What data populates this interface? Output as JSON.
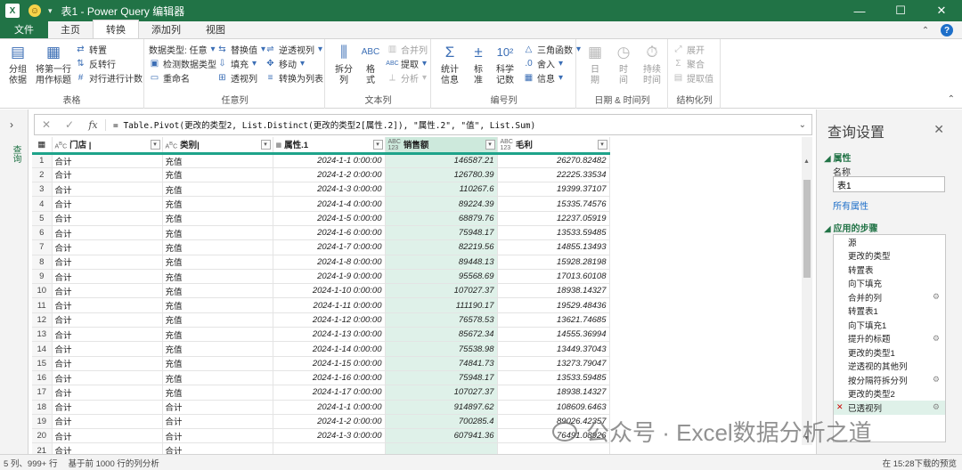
{
  "window": {
    "title": "表1 - Power Query 编辑器",
    "app_badge": "X",
    "minimize_glyph": "—",
    "maximize_glyph": "☐",
    "close_glyph": "✕"
  },
  "tabs": [
    "文件",
    "主页",
    "转换",
    "添加列",
    "视图"
  ],
  "ribbon": {
    "groups": {
      "table": "表格",
      "any_col": "任意列",
      "text_col": "文本列",
      "number_col": "编号列",
      "datetime_col": "日期 & 时间列",
      "structured_col": "结构化列"
    },
    "group_by": "分组\n依据",
    "first_row_header": "将第一行\n用作标题",
    "transpose": "转置",
    "reverse_rows": "反转行",
    "count_rows": "对行进行计数",
    "data_type": "数据类型: 任意",
    "detect_type": "检测数据类型",
    "rename": "重命名",
    "replace_values": "替换值",
    "fill": "填充",
    "pivot_column": "透视列",
    "unpivot": "逆透视列",
    "move": "移动",
    "to_list": "转换为列表",
    "split_column": "拆分\n列",
    "format": "格\n式",
    "merge_columns": "合并列",
    "extract": "提取",
    "parse": "分析",
    "statistics": "统计\n信息",
    "standard": "标\n准",
    "scientific": "科学\n记数",
    "trig": "三角函数",
    "rounding": "舍入",
    "information": "信息",
    "date": "日\n期",
    "time": "时\n间",
    "duration": "持续\n时间",
    "expand": "展开",
    "aggregate": "聚合",
    "extract_values": "提取值"
  },
  "formula": "= Table.Pivot(更改的类型2, List.Distinct(更改的类型2[属性.2]), \"属性.2\", \"值\", List.Sum)",
  "left_pane_label": "查询",
  "columns": [
    {
      "name": "门店",
      "type": "ABC"
    },
    {
      "name": "类别",
      "type": "ABC"
    },
    {
      "name": "属性.1",
      "type": "date"
    },
    {
      "name": "销售额",
      "type": "ABC123"
    },
    {
      "name": "毛利",
      "type": "ABC123"
    }
  ],
  "rows": [
    [
      "1",
      "合计",
      "充值",
      "2024-1-1 0:00:00",
      "146587.21",
      "26270.82482"
    ],
    [
      "2",
      "合计",
      "充值",
      "2024-1-2 0:00:00",
      "126780.39",
      "22225.33534"
    ],
    [
      "3",
      "合计",
      "充值",
      "2024-1-3 0:00:00",
      "110267.6",
      "19399.37107"
    ],
    [
      "4",
      "合计",
      "充值",
      "2024-1-4 0:00:00",
      "89224.39",
      "15335.74576"
    ],
    [
      "5",
      "合计",
      "充值",
      "2024-1-5 0:00:00",
      "68879.76",
      "12237.05919"
    ],
    [
      "6",
      "合计",
      "充值",
      "2024-1-6 0:00:00",
      "75948.17",
      "13533.59485"
    ],
    [
      "7",
      "合计",
      "充值",
      "2024-1-7 0:00:00",
      "82219.56",
      "14855.13493"
    ],
    [
      "8",
      "合计",
      "充值",
      "2024-1-8 0:00:00",
      "89448.13",
      "15928.28198"
    ],
    [
      "9",
      "合计",
      "充值",
      "2024-1-9 0:00:00",
      "95568.69",
      "17013.60108"
    ],
    [
      "10",
      "合计",
      "充值",
      "2024-1-10 0:00:00",
      "107027.37",
      "18938.14327"
    ],
    [
      "11",
      "合计",
      "充值",
      "2024-1-11 0:00:00",
      "111190.17",
      "19529.48436"
    ],
    [
      "12",
      "合计",
      "充值",
      "2024-1-12 0:00:00",
      "76578.53",
      "13621.74685"
    ],
    [
      "13",
      "合计",
      "充值",
      "2024-1-13 0:00:00",
      "85672.34",
      "14555.36994"
    ],
    [
      "14",
      "合计",
      "充值",
      "2024-1-14 0:00:00",
      "75538.98",
      "13449.37043"
    ],
    [
      "15",
      "合计",
      "充值",
      "2024-1-15 0:00:00",
      "74841.73",
      "13273.79047"
    ],
    [
      "16",
      "合计",
      "充值",
      "2024-1-16 0:00:00",
      "75948.17",
      "13533.59485"
    ],
    [
      "17",
      "合计",
      "充值",
      "2024-1-17 0:00:00",
      "107027.37",
      "18938.14327"
    ],
    [
      "18",
      "合计",
      "合计",
      "2024-1-1 0:00:00",
      "914897.62",
      "108609.6463"
    ],
    [
      "19",
      "合计",
      "合计",
      "2024-1-2 0:00:00",
      "700285.4",
      "89026.42357"
    ],
    [
      "20",
      "合计",
      "合计",
      "2024-1-3 0:00:00",
      "607941.36",
      "76491.08926"
    ],
    [
      "21",
      "合计",
      "合计",
      "",
      "",
      ""
    ]
  ],
  "right_pane": {
    "title": "查询设置",
    "properties_header": "属性",
    "name_label": "名称",
    "name_value": "表1",
    "all_properties": "所有属性",
    "steps_header": "应用的步骤",
    "steps": [
      {
        "label": "源",
        "gear": false
      },
      {
        "label": "更改的类型",
        "gear": false
      },
      {
        "label": "转置表",
        "gear": false
      },
      {
        "label": "向下填充",
        "gear": false
      },
      {
        "label": "合并的列",
        "gear": true
      },
      {
        "label": "转置表1",
        "gear": false
      },
      {
        "label": "向下填充1",
        "gear": false
      },
      {
        "label": "提升的标题",
        "gear": true
      },
      {
        "label": "更改的类型1",
        "gear": false
      },
      {
        "label": "逆透视的其他列",
        "gear": false
      },
      {
        "label": "按分隔符拆分列",
        "gear": true
      },
      {
        "label": "更改的类型2",
        "gear": false
      },
      {
        "label": "已透视列",
        "gear": true,
        "active": true
      }
    ]
  },
  "status": {
    "dims": "5 列、999+ 行",
    "profile": "基于前 1000 行的列分析",
    "preview": "在 15:28下载的预览"
  },
  "watermark": "公众号 · Excel数据分析之道",
  "colors": {
    "accent": "#217346",
    "selected_column": "#dff1e9",
    "header_underline": "#1ea38a"
  }
}
